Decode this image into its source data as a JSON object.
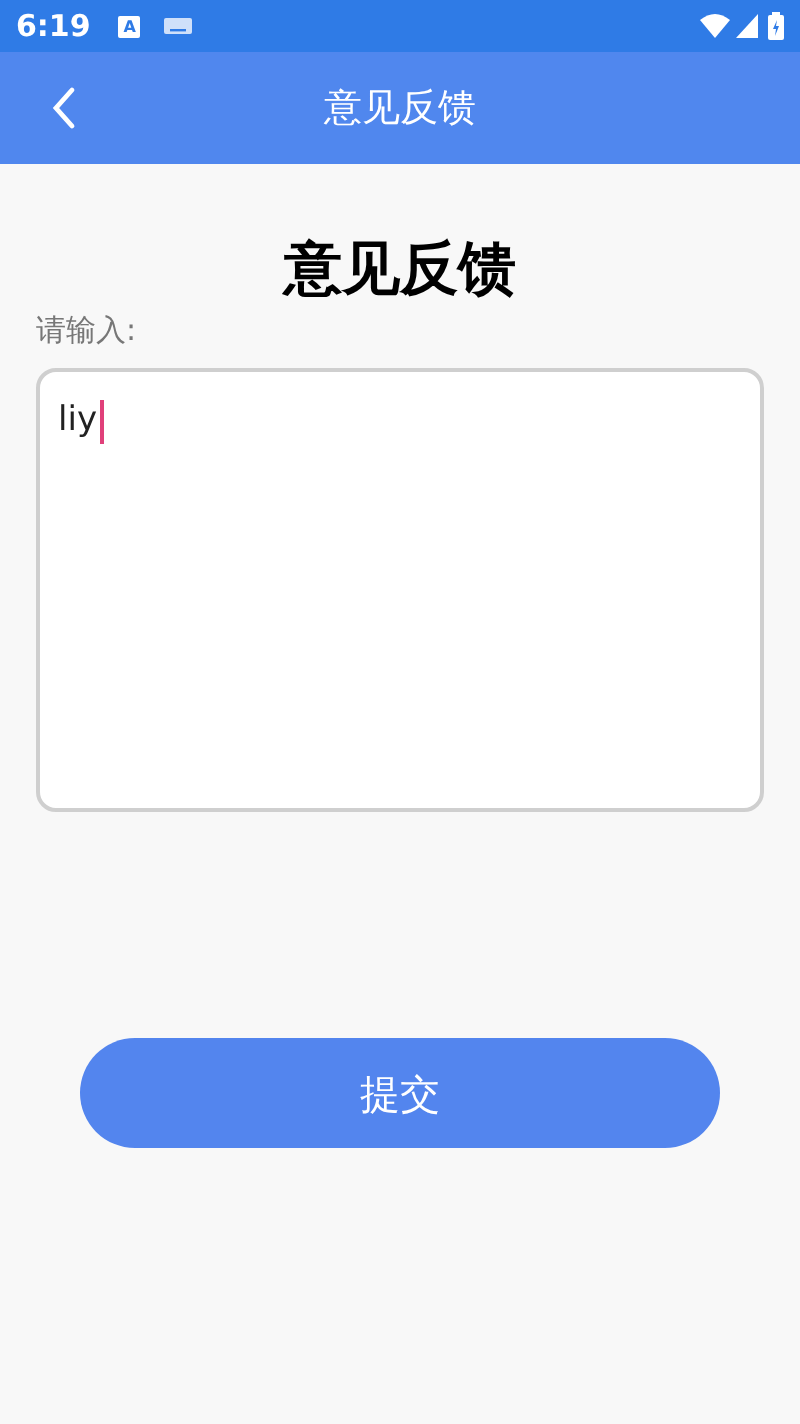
{
  "status_bar": {
    "time": "6:19",
    "badge": "A"
  },
  "app_bar": {
    "title": "意见反馈"
  },
  "heading": "意见反馈",
  "field": {
    "label": "请输入:",
    "value": "liy",
    "focused": true
  },
  "submit_button": "提交"
}
